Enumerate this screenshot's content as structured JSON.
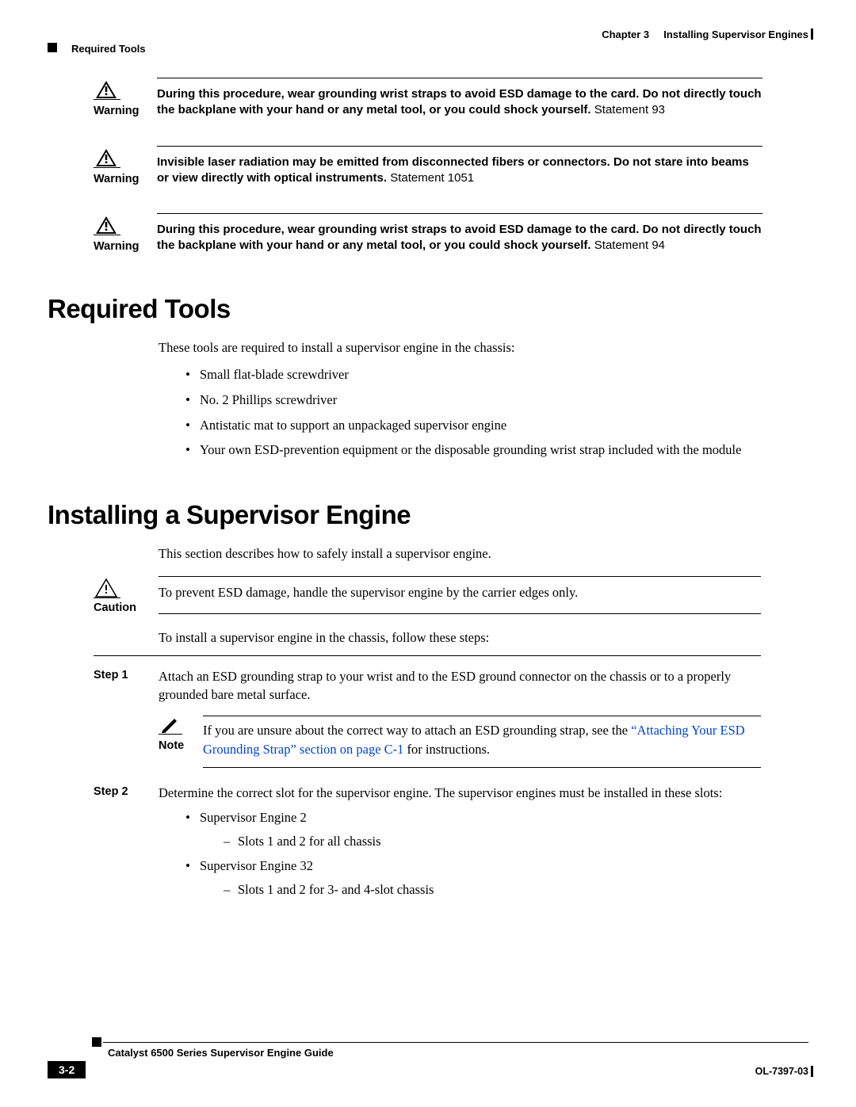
{
  "header": {
    "chapter_label": "Chapter 3",
    "chapter_title": "Installing Supervisor Engines",
    "section_current": "Required Tools"
  },
  "warnings": [
    {
      "label": "Warning",
      "bold_text": "During this procedure, wear grounding wrist straps to avoid ESD damage to the card. Do not directly touch the backplane with your hand or any metal tool, or you could shock yourself.",
      "statement": " Statement 93"
    },
    {
      "label": "Warning",
      "bold_text": "Invisible laser radiation may be emitted from disconnected fibers or connectors. Do not stare into beams or view directly with optical instruments.",
      "statement": " Statement 1051"
    },
    {
      "label": "Warning",
      "bold_text": "During this procedure, wear grounding wrist straps to avoid ESD damage to the card. Do not directly touch the backplane with your hand or any metal tool, or you could shock yourself.",
      "statement": " Statement 94"
    }
  ],
  "h_required_tools": "Required Tools",
  "required_tools": {
    "intro": "These tools are required to install a supervisor engine in the chassis:",
    "items": [
      "Small flat-blade screwdriver",
      "No. 2 Phillips screwdriver",
      "Antistatic mat to support an unpackaged supervisor engine",
      "Your own ESD-prevention equipment or the disposable grounding wrist strap included with the module"
    ]
  },
  "h_install": "Installing a Supervisor Engine",
  "install_intro": "This section describes how to safely install a supervisor engine.",
  "caution": {
    "label": "Caution",
    "text": "To prevent ESD damage, handle the supervisor engine by the carrier edges only."
  },
  "install_lead": "To install a supervisor engine in the chassis, follow these steps:",
  "steps": [
    {
      "label": "Step 1",
      "text": "Attach an ESD grounding strap to your wrist and to the ESD ground connector on the chassis or to a properly grounded bare metal surface.",
      "note": {
        "label": "Note",
        "pre": "If you are unsure about the correct way to attach an ESD grounding strap, see the ",
        "link": "“Attaching Your ESD Grounding Strap” section on page C-1",
        "post": " for instructions."
      }
    },
    {
      "label": "Step 2",
      "text": "Determine the correct slot for the supervisor engine. The supervisor engines must be installed in these slots:",
      "bullets": [
        {
          "t": "Supervisor Engine 2",
          "sub": [
            "Slots 1 and 2 for all chassis"
          ]
        },
        {
          "t": "Supervisor Engine 32",
          "sub": [
            "Slots 1 and 2 for 3- and 4-slot chassis"
          ]
        }
      ]
    }
  ],
  "footer": {
    "book_title": "Catalyst 6500 Series Supervisor Engine Guide",
    "page": "3-2",
    "docnum": "OL-7397-03"
  }
}
